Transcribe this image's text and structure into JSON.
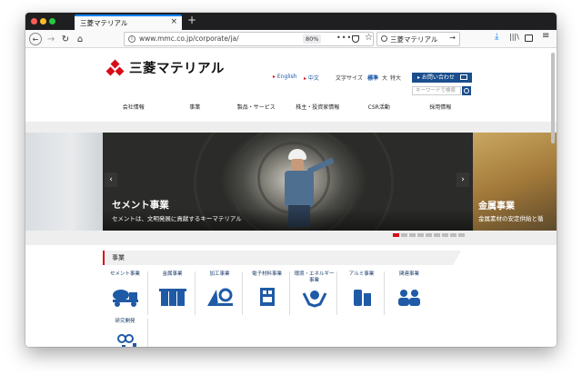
{
  "browser": {
    "tab_title": "三菱マテリアル",
    "url": "www.mmc.co.jp/corporate/ja/",
    "zoom": "80%",
    "search_text": "三菱マテリアル"
  },
  "header": {
    "logo_text": "三菱マテリアル",
    "lang_en": "English",
    "lang_zh": "中文",
    "font_size_label": "文字サイズ",
    "font_size_std": "標準",
    "font_size_large": "大",
    "font_size_xlarge": "特大",
    "contact_label": "お問い合わせ",
    "search_placeholder": "キーワードで検索"
  },
  "nav": [
    "会社情報",
    "事業",
    "製品・サービス",
    "株主・投資家情報",
    "CSR活動",
    "採用情報"
  ],
  "hero": {
    "main_caption": "セメント事業",
    "main_sub": "セメントは、文明発展に貢献するキーマテリアル",
    "right_caption": "金属事業",
    "right_sub": "金属素材の安定供給と循"
  },
  "business": {
    "title": "事業",
    "items": [
      {
        "label": "セメント事業",
        "icon": "cement-truck-icon"
      },
      {
        "label": "金属事業",
        "icon": "metal-ingot-icon"
      },
      {
        "label": "加工事業",
        "icon": "tool-gear-icon"
      },
      {
        "label": "電子材料事業",
        "icon": "electronics-chip-icon"
      },
      {
        "label": "環境・エネルギー事業",
        "icon": "environment-hands-icon"
      },
      {
        "label": "アルミ事業",
        "icon": "aluminum-can-icon"
      },
      {
        "label": "関連事業",
        "icon": "people-icon"
      },
      {
        "label": "研究開発",
        "icon": "research-chart-icon"
      }
    ]
  },
  "colors": {
    "brand_red": "#d70c18",
    "brand_blue": "#1a4e8c",
    "icon_blue": "#1f5aa6"
  }
}
